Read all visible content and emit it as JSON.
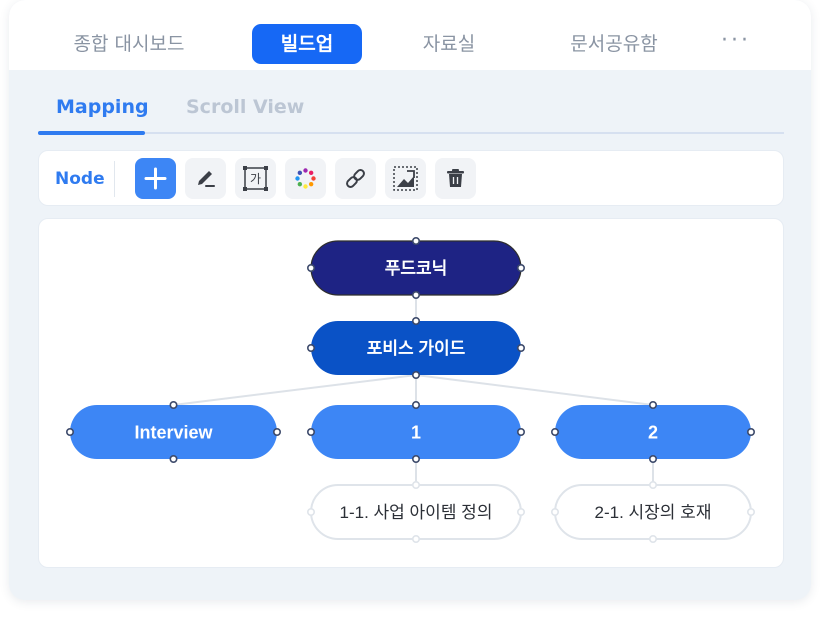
{
  "topnav": {
    "items": [
      {
        "label": "종합 대시보드",
        "active": false
      },
      {
        "label": "빌드업",
        "active": true
      },
      {
        "label": "자료실",
        "active": false
      },
      {
        "label": "문서공유함",
        "active": false
      }
    ],
    "more_label": "···"
  },
  "subtabs": [
    {
      "label": "Mapping",
      "active": true
    },
    {
      "label": "Scroll View",
      "active": false
    }
  ],
  "toolbar": {
    "label": "Node",
    "tools": [
      {
        "icon": "plus-icon",
        "active": true
      },
      {
        "icon": "edit-pen-icon"
      },
      {
        "icon": "text-box-icon",
        "glyph": "가"
      },
      {
        "icon": "color-palette-icon"
      },
      {
        "icon": "link-icon"
      },
      {
        "icon": "image-icon"
      },
      {
        "icon": "trash-icon"
      }
    ]
  },
  "mindmap": {
    "nodes": [
      {
        "id": "root",
        "label": "푸드코닉",
        "style": "root"
      },
      {
        "id": "guide",
        "label": "포비스 가이드",
        "style": "level1"
      },
      {
        "id": "interview",
        "label": "Interview",
        "style": "level2"
      },
      {
        "id": "n1",
        "label": "1",
        "style": "level2"
      },
      {
        "id": "n2",
        "label": "2",
        "style": "level2"
      },
      {
        "id": "n1-1",
        "label": "1-1. 사업 아이템 정의",
        "style": "leaf"
      },
      {
        "id": "n2-1",
        "label": "2-1. 시장의 호재",
        "style": "leaf"
      }
    ],
    "edges": [
      [
        "root",
        "guide"
      ],
      [
        "guide",
        "interview"
      ],
      [
        "guide",
        "n1"
      ],
      [
        "guide",
        "n2"
      ],
      [
        "n1",
        "n1-1"
      ],
      [
        "n2",
        "n2-1"
      ]
    ],
    "colors": {
      "root": "#1e2384",
      "level1": "#0a52c6",
      "level2": "#3d86f5",
      "leaf_border": "#dfe4ea",
      "edge": "#dde2e8",
      "handle": "#3d4a6b"
    }
  }
}
